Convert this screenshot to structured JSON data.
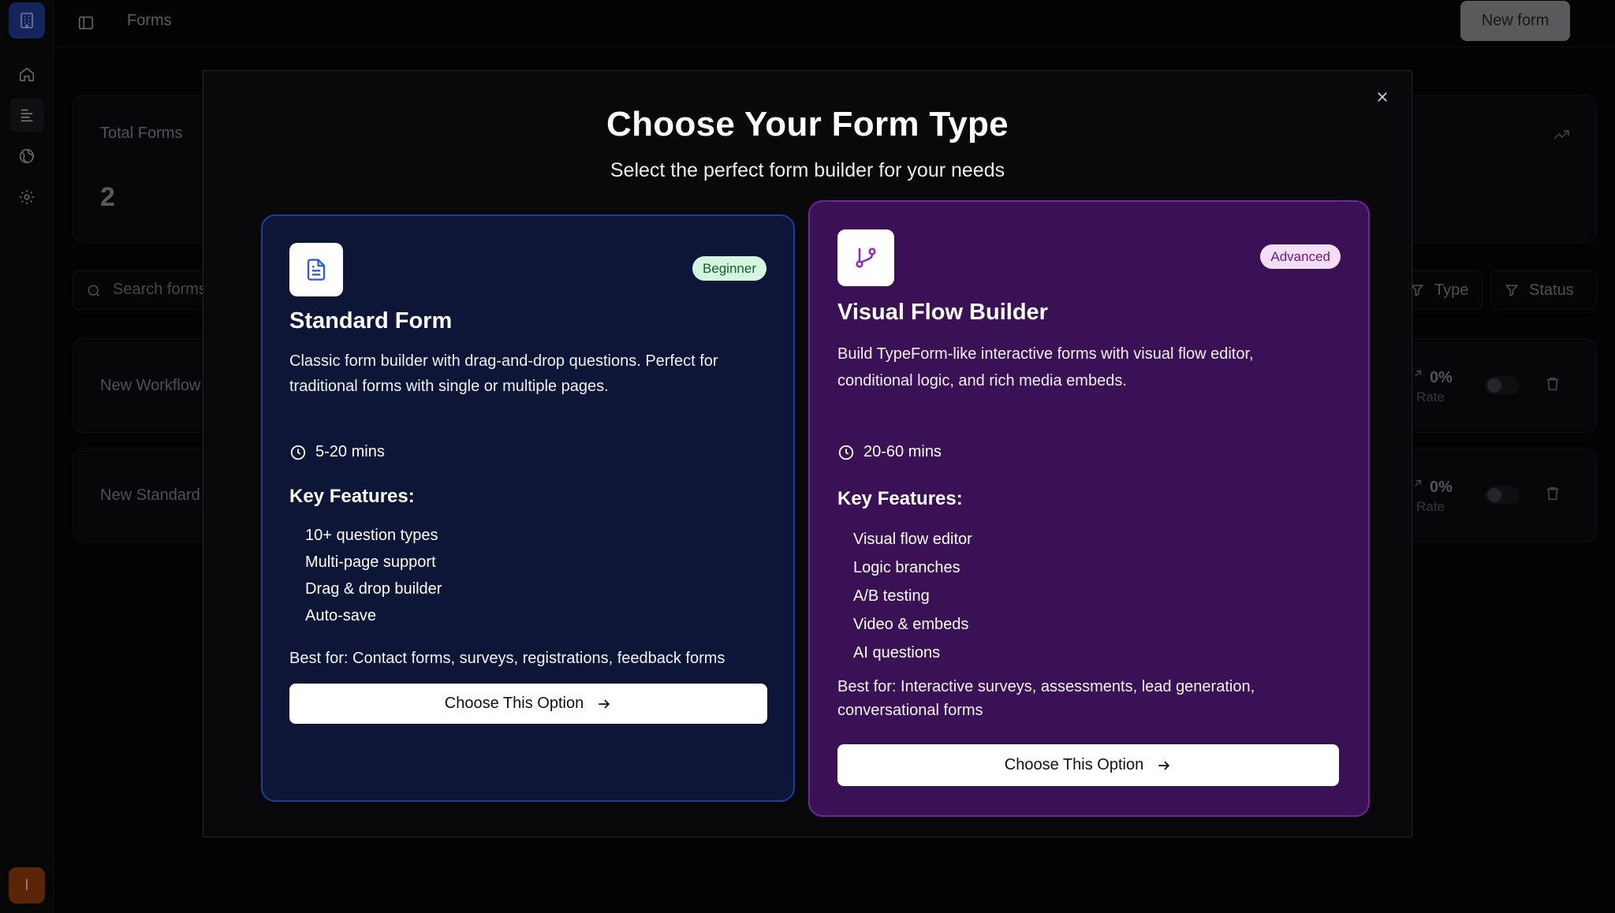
{
  "app": {
    "breadcrumb": "Forms",
    "new_form_label": "New form",
    "user_initial": "I"
  },
  "sidebar": {
    "items": [
      {
        "icon": "home-icon"
      },
      {
        "icon": "forms-list-icon"
      },
      {
        "icon": "globe-icon"
      },
      {
        "icon": "gear-icon"
      }
    ]
  },
  "stats": {
    "total_forms_label": "Total Forms",
    "total_forms_value": "2"
  },
  "search": {
    "placeholder": "Search forms..."
  },
  "filters": {
    "type_label": "Type",
    "status_label": "Status"
  },
  "rows": [
    {
      "name": "New Workflow",
      "rate_value": "0%",
      "rate_label": "Rate"
    },
    {
      "name": "New Standard",
      "rate_value": "0%",
      "rate_label": "Rate"
    }
  ],
  "modal": {
    "title": "Choose Your Form Type",
    "subtitle": "Select the perfect form builder for your needs",
    "options": [
      {
        "title": "Standard Form",
        "badge": "Beginner",
        "description": "Classic form builder with drag-and-drop questions. Perfect for traditional forms with single or multiple pages.",
        "time": "5-20 mins",
        "key_features_label": "Key Features:",
        "features": [
          "10+ question types",
          "Multi-page support",
          "Drag & drop builder",
          "Auto-save"
        ],
        "best_for": "Best for: Contact forms, surveys, registrations, feedback forms",
        "button_label": "Choose This Option"
      },
      {
        "title": "Visual Flow Builder",
        "badge": "Advanced",
        "description": "Build TypeForm-like interactive forms with visual flow editor, conditional logic, and rich media embeds.",
        "time": "20-60 mins",
        "key_features_label": "Key Features:",
        "features": [
          "Visual flow editor",
          "Logic branches",
          "A/B testing",
          "Video & embeds",
          "AI questions"
        ],
        "best_for": "Best for: Interactive surveys, assessments, lead generation, conversational forms",
        "button_label": "Choose This Option"
      }
    ]
  },
  "colors": {
    "standard_card_bg": "#0d1636",
    "standard_card_border": "#1f3d9a",
    "flow_card_bg": "#3b1155",
    "flow_card_border": "#6d2896",
    "standard_icon": "#2f5fd0",
    "flow_icon": "#8a2bc2"
  }
}
